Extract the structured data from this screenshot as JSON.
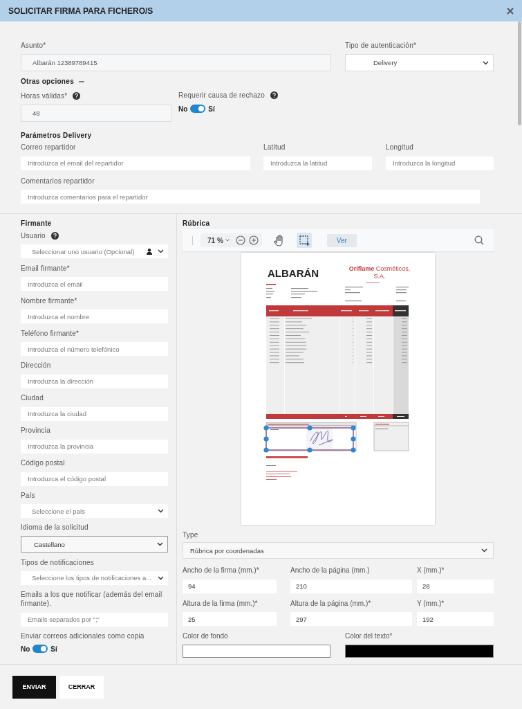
{
  "window": {
    "title": "SOLICITAR FIRMA PARA FICHERO/S"
  },
  "subject": {
    "label": "Asunto*",
    "kind": "text",
    "value": "Albarán 12389789415"
  },
  "auth_type": {
    "label": "Tipo de autenticación*",
    "kind": "select",
    "value": "Delivery"
  },
  "other_options": {
    "title": "Otras opciones",
    "expanded": true
  },
  "valid_hours": {
    "label": "Horas válidas*",
    "kind": "text",
    "value": "48",
    "help": true
  },
  "reject_reason": {
    "label": "Requerir causa de rechazo",
    "help": true,
    "off_label": "No",
    "on_label": "Sí",
    "on": true
  },
  "delivery": {
    "title": "Parámetros Delivery",
    "fields": [
      {
        "label": "Correo repartidor",
        "kind": "input",
        "placeholder": "Introduzca el email del repartidor"
      },
      {
        "label": "Latitud",
        "kind": "input",
        "placeholder": "Introduzca la latitud"
      },
      {
        "label": "Longitud",
        "kind": "input",
        "placeholder": "Introduzca la longitud"
      },
      {
        "label": "Comentarios repartidor",
        "kind": "input",
        "placeholder": "Introduzca comentarios para el repartidor"
      }
    ]
  },
  "signer": {
    "title": "Firmante",
    "fields": [
      {
        "label": "Usuario",
        "kind": "user-select",
        "placeholder": "Seleccionar uno usuario (Opcional)",
        "help": true
      },
      {
        "label": "Email firmante*",
        "kind": "input",
        "placeholder": "Introduzca el email"
      },
      {
        "label": "Nombre firmante*",
        "kind": "input",
        "placeholder": "Introduzca el nombre"
      },
      {
        "label": "Teléfono firmante*",
        "kind": "input",
        "placeholder": "Introduzca el número telefónico"
      },
      {
        "label": "Dirección",
        "kind": "input",
        "placeholder": "Introduzca la dirección"
      },
      {
        "label": "Ciudad",
        "kind": "input",
        "placeholder": "Introduzca la ciudad"
      },
      {
        "label": "Provincia",
        "kind": "input",
        "placeholder": "Introduzca la provincia"
      },
      {
        "label": "Código postal",
        "kind": "input",
        "placeholder": "Introduzca el código postal"
      },
      {
        "label": "País",
        "kind": "select",
        "placeholder": "Seleccione el país"
      },
      {
        "label": "Idioma de la solicitud",
        "kind": "boxed-select",
        "value": "Castellano"
      },
      {
        "label": "Tipos de notificaciones",
        "kind": "select",
        "placeholder": "Seleccione los tipos de notificaciones a..."
      },
      {
        "label": "Emails a los que notificar (además del email firmante).",
        "kind": "input",
        "placeholder": "Emails separados por \";\""
      },
      {
        "label": "Enviar correos adicionales como copia",
        "kind": "toggle",
        "off_label": "No",
        "on_label": "Sí",
        "on": true
      }
    ]
  },
  "rubric": {
    "title": "Rúbrica",
    "toolbar": {
      "zoom": "71 %",
      "tools": [
        {
          "kind": "pan",
          "selected": false
        },
        {
          "kind": "area",
          "selected": true
        }
      ],
      "view_button": "Ver"
    },
    "document": {
      "title": "ALBARÁN",
      "company": "**Oriflame** Cosméticos, S.A."
    }
  },
  "signature_type": {
    "label": "Type",
    "value": "Rúbrica por coordenadas"
  },
  "coordinates": [
    {
      "label": "Ancho de la firma (mm.)*",
      "value": "94"
    },
    {
      "label": "Ancho de la página (mm.)",
      "value": "210"
    },
    {
      "label": "X (mm.)*",
      "value": "28"
    },
    {
      "label": "Altura de la firma (mm.)*",
      "value": "25"
    },
    {
      "label": "Altura de la página (mm.)*",
      "value": "297"
    },
    {
      "label": "Y (mm.)*",
      "value": "192"
    }
  ],
  "colors": [
    {
      "label": "Color de fondo",
      "color": "#ffffff"
    },
    {
      "label": "Color del texto*",
      "color": "#000000"
    }
  ],
  "buttons": [
    {
      "label": "ENVIAR",
      "kind": "primary"
    },
    {
      "label": "CERRAR",
      "kind": "secondary"
    }
  ]
}
